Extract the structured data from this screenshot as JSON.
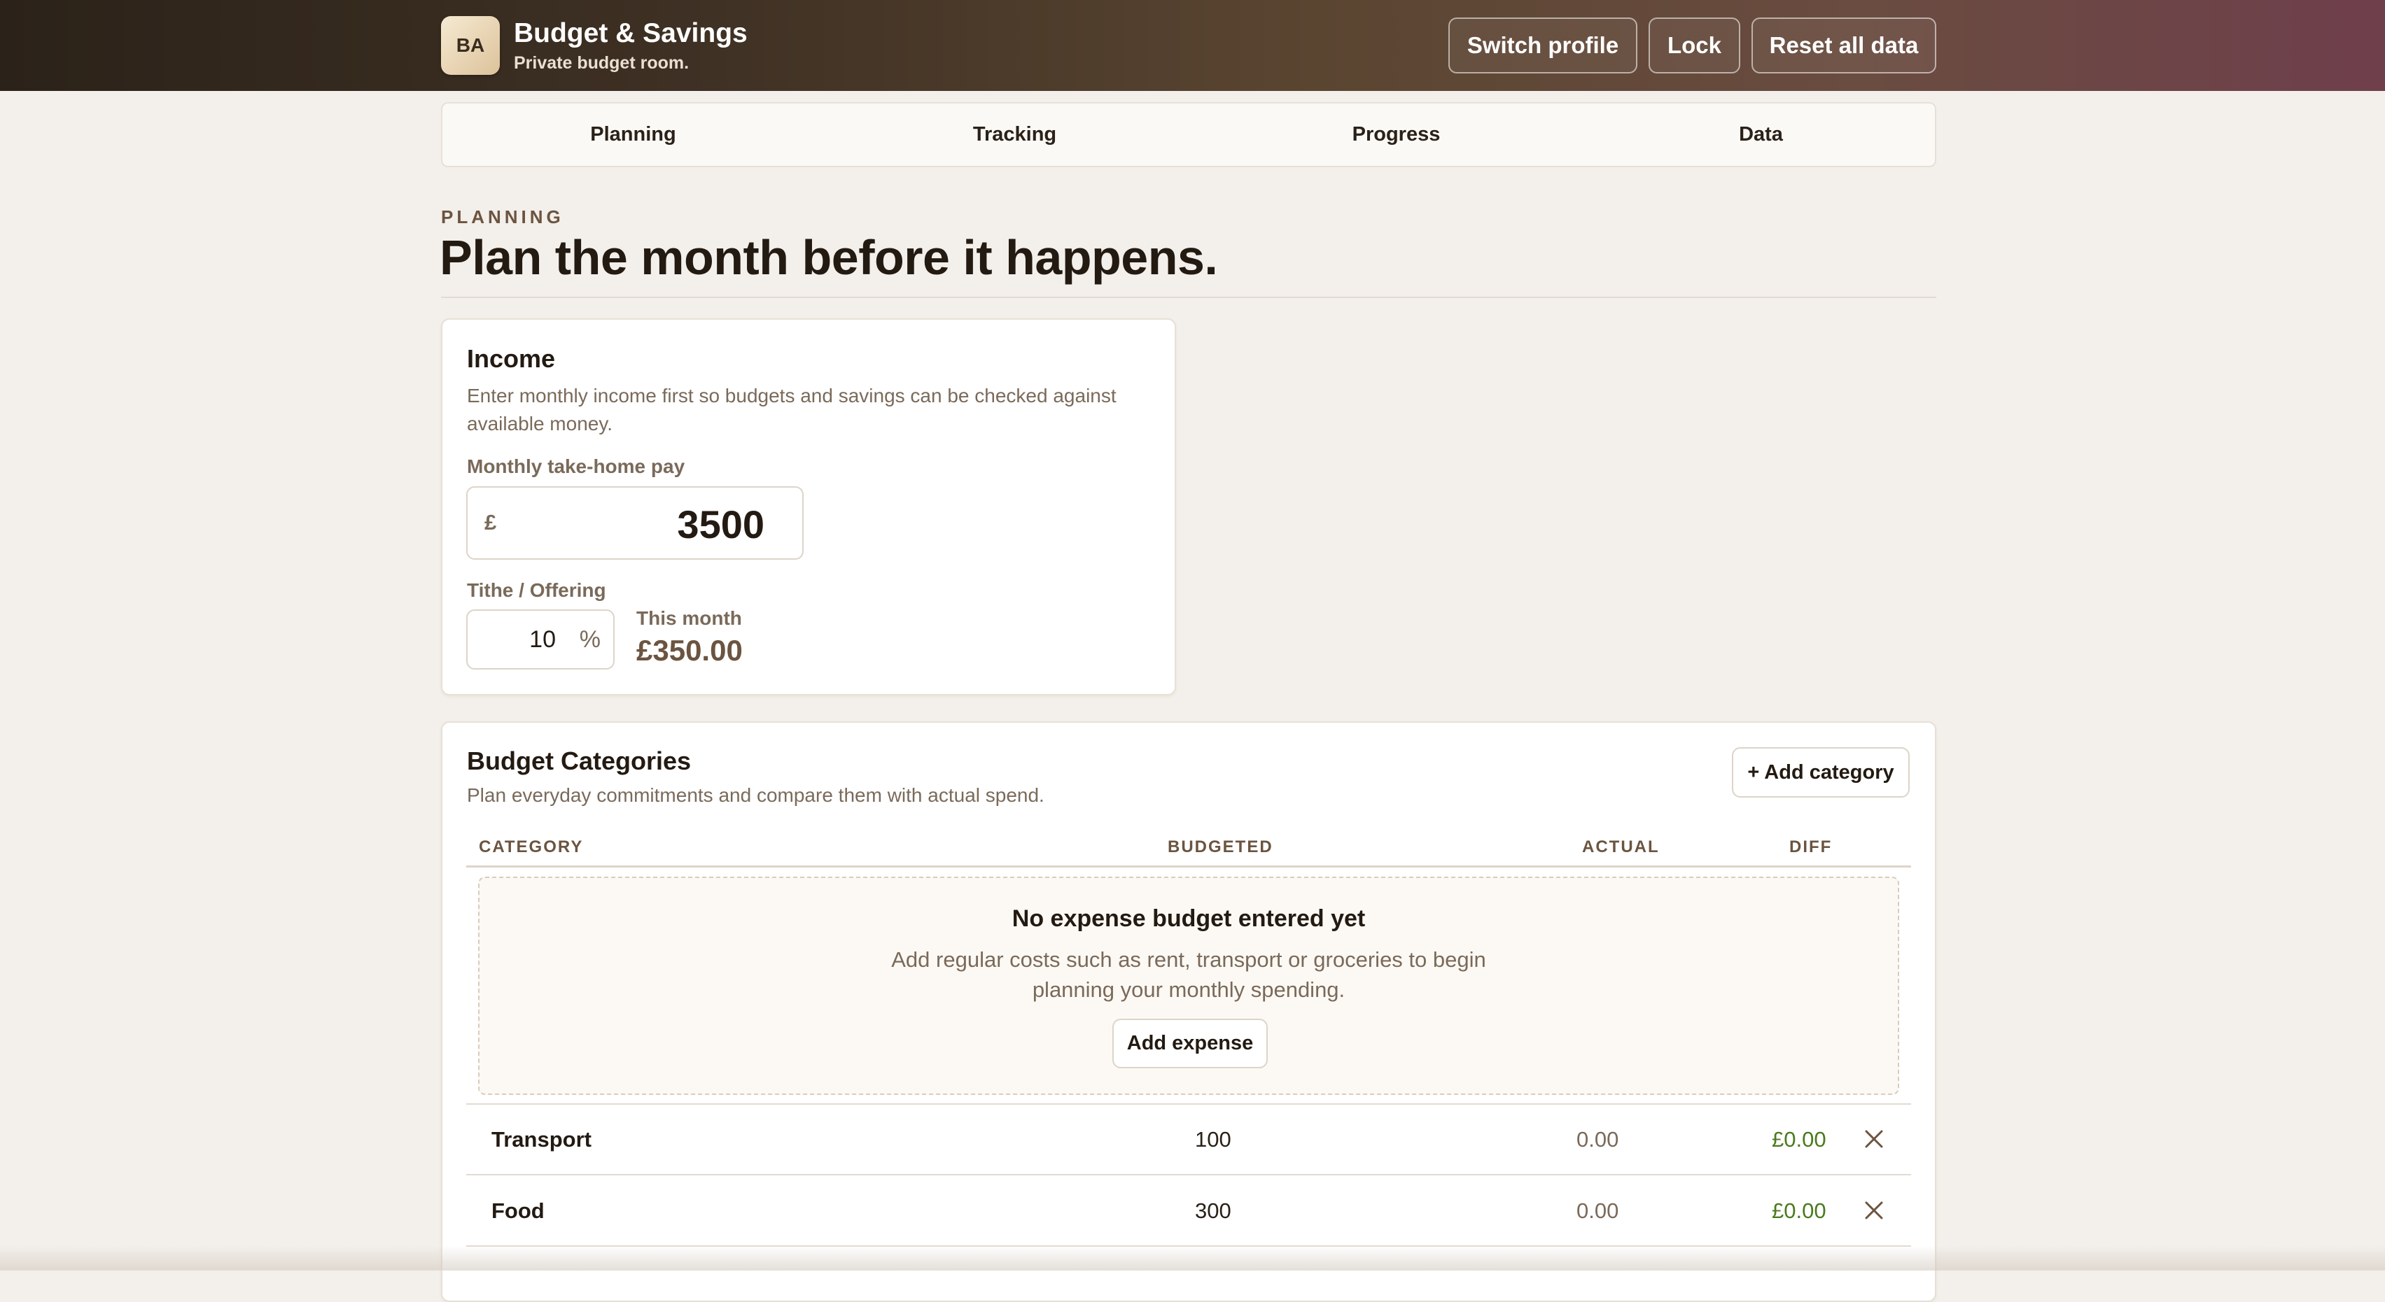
{
  "app": {
    "badge": "BA",
    "title": "Budget & Savings",
    "subtitle": "Private budget room."
  },
  "header": {
    "switch_profile": "Switch profile",
    "lock": "Lock",
    "reset": "Reset all data"
  },
  "tabs": [
    "Planning",
    "Tracking",
    "Progress",
    "Data"
  ],
  "page": {
    "kicker": "PLANNING",
    "title": "Plan the month before it happens."
  },
  "income": {
    "title": "Income",
    "description_line1": "Enter monthly income first so budgets and savings can be checked against",
    "description_line2": "available money.",
    "pay_label": "Monthly take-home pay",
    "currency": "£",
    "pay_value": "3500",
    "tithe_label": "Tithe / Offering",
    "tithe_value": "10",
    "tithe_unit": "%",
    "this_month_label": "This month",
    "this_month_value": "£350.00"
  },
  "budget": {
    "title": "Budget Categories",
    "description": "Plan everyday commitments and compare them with actual spend.",
    "add_category": "+ Add category",
    "columns": {
      "category": "CATEGORY",
      "budgeted": "BUDGETED",
      "actual": "ACTUAL",
      "diff": "DIFF"
    },
    "empty": {
      "title": "No expense budget entered yet",
      "text_line1": "Add regular costs such as rent, transport or groceries to begin",
      "text_line2": "planning your monthly spending.",
      "button": "Add expense"
    },
    "rows": [
      {
        "category": "Transport",
        "budgeted": "100",
        "actual": "0.00",
        "diff": "£0.00"
      },
      {
        "category": "Food",
        "budgeted": "300",
        "actual": "0.00",
        "diff": "£0.00"
      }
    ]
  },
  "colors": {
    "accent_dark": "#2b2219",
    "accent_plum": "#6f3f4c",
    "positive": "#4b7a1e",
    "background": "#f3efea"
  }
}
